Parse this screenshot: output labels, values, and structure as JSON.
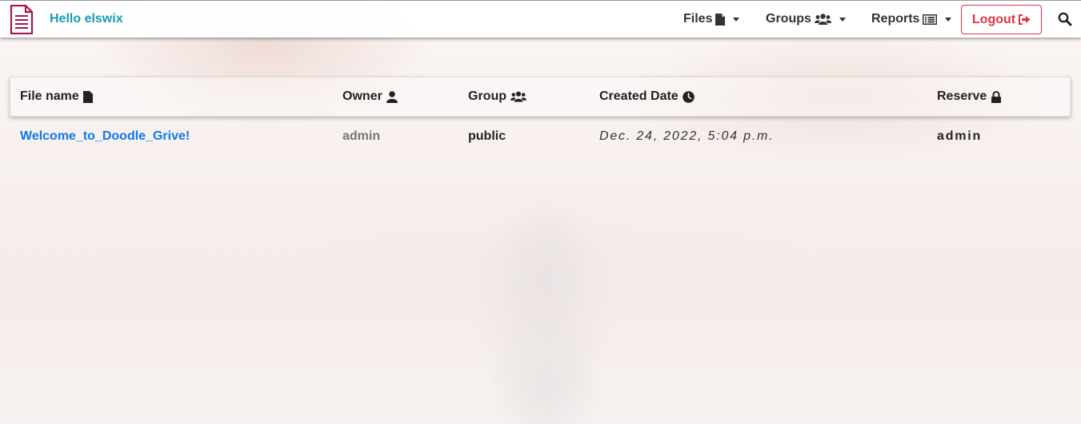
{
  "nav": {
    "brand": "Hello elswix",
    "files_label": "Files",
    "groups_label": "Groups",
    "reports_label": "Reports",
    "logout_label": "Logout",
    "accent_color": "#1a9bb5",
    "logout_color": "#dc3545",
    "icons": {
      "logo": "document-icon",
      "files": "file-icon",
      "groups": "users-icon",
      "reports": "list-icon",
      "logout": "sign-out-icon",
      "search": "search-icon"
    }
  },
  "table": {
    "headers": [
      {
        "label": "File name",
        "icon": "file-icon"
      },
      {
        "label": "Owner",
        "icon": "user-icon"
      },
      {
        "label": "Group",
        "icon": "users-icon"
      },
      {
        "label": "Created Date",
        "icon": "clock-icon"
      },
      {
        "label": "Reserve",
        "icon": "lock-icon"
      }
    ],
    "rows": [
      {
        "file_name": "Welcome_to_Doodle_Grive!",
        "owner": "admin",
        "group": "public",
        "created_date": "Dec. 24, 2022, 5:04 p.m.",
        "reserve": "admin"
      }
    ],
    "link_color": "#0d7be8"
  }
}
